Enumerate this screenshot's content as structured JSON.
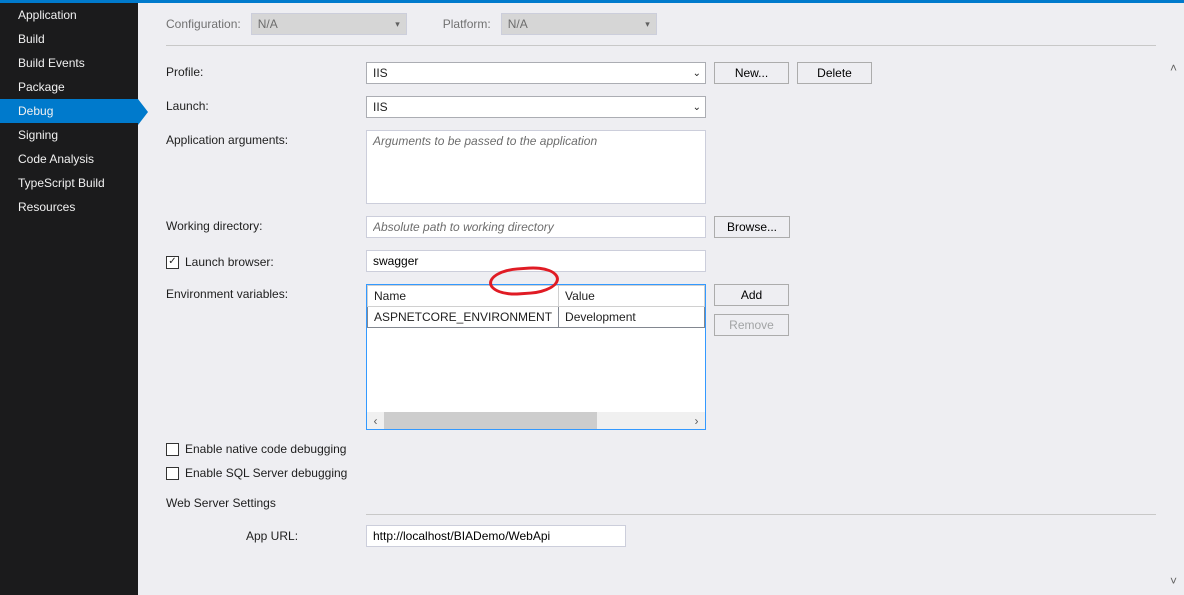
{
  "sidebar": {
    "items": [
      {
        "label": "Application"
      },
      {
        "label": "Build"
      },
      {
        "label": "Build Events"
      },
      {
        "label": "Package"
      },
      {
        "label": "Debug"
      },
      {
        "label": "Signing"
      },
      {
        "label": "Code Analysis"
      },
      {
        "label": "TypeScript Build"
      },
      {
        "label": "Resources"
      }
    ],
    "selected_index": 4
  },
  "top": {
    "configuration_label": "Configuration:",
    "configuration_value": "N/A",
    "platform_label": "Platform:",
    "platform_value": "N/A"
  },
  "form": {
    "profile_label": "Profile:",
    "profile_value": "IIS",
    "new_btn": "New...",
    "delete_btn": "Delete",
    "launch_label": "Launch:",
    "launch_value": "IIS",
    "appargs_label": "Application arguments:",
    "appargs_placeholder": "Arguments to be passed to the application",
    "appargs_value": "",
    "workdir_label": "Working directory:",
    "workdir_placeholder": "Absolute path to working directory",
    "workdir_value": "",
    "browse_btn": "Browse...",
    "launchbrowser_label": "Launch browser:",
    "launchbrowser_checked": true,
    "launchbrowser_value": "swagger",
    "envvars_label": "Environment variables:",
    "envtable": {
      "col_name": "Name",
      "col_value": "Value",
      "rows": [
        {
          "name": "ASPNETCORE_ENVIRONMENT",
          "value": "Development"
        }
      ]
    },
    "add_btn": "Add",
    "remove_btn": "Remove",
    "enable_native_label": "Enable native code debugging",
    "enable_native_checked": false,
    "enable_sqlserver_label": "Enable SQL Server debugging",
    "enable_sqlserver_checked": false,
    "webserver_title": "Web Server Settings",
    "appurl_label": "App URL:",
    "appurl_value": "http://localhost/BIADemo/WebApi"
  }
}
